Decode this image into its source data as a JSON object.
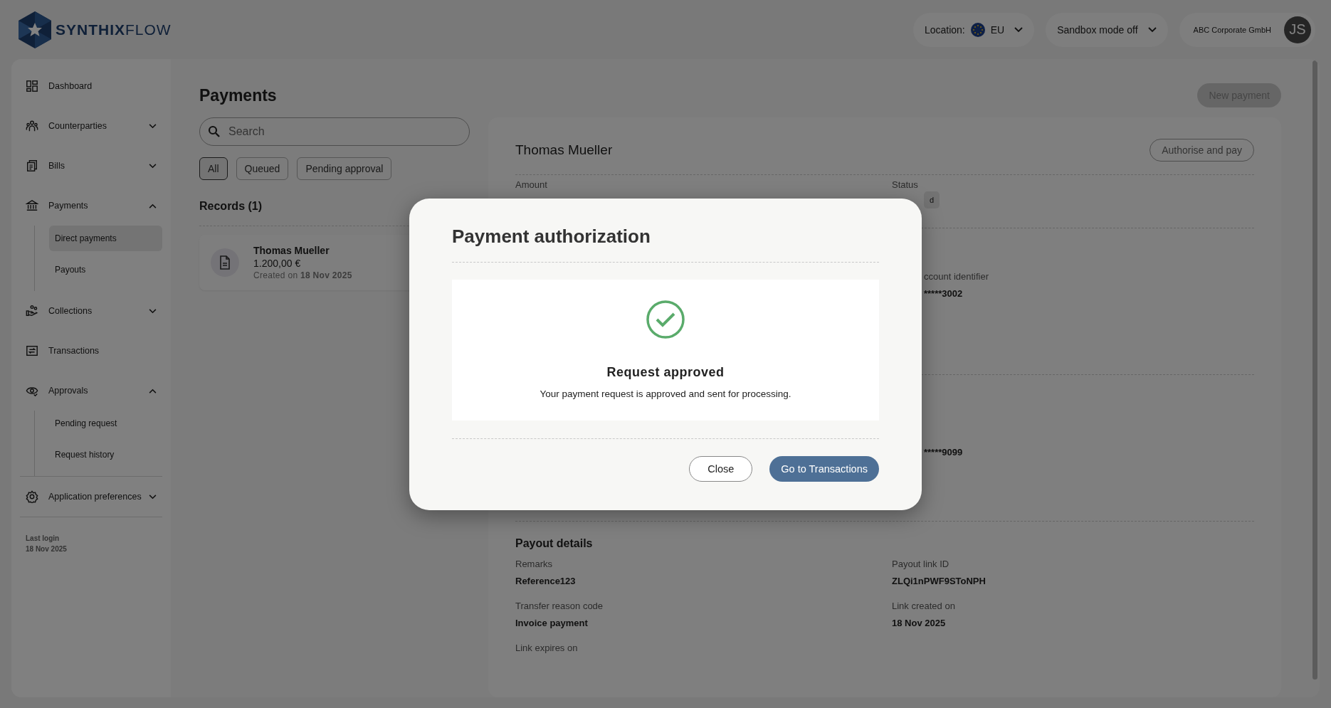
{
  "brand": {
    "name": "**SYNTHIX**FLOW"
  },
  "header": {
    "location_label": "Location:",
    "location_value": "EU",
    "sandbox": "Sandbox mode off",
    "company": "ABC Corporate GmbH",
    "avatar": "JS"
  },
  "sidebar": {
    "items": [
      {
        "label": "Dashboard"
      },
      {
        "label": "Counterparties",
        "expanded": false
      },
      {
        "label": "Bills",
        "expanded": false
      },
      {
        "label": "Payments",
        "expanded": true,
        "children": [
          {
            "label": "Direct payments",
            "selected": true
          },
          {
            "label": "Payouts",
            "selected": false
          }
        ]
      },
      {
        "label": "Collections",
        "expanded": false
      },
      {
        "label": "Transactions"
      },
      {
        "label": "Approvals",
        "expanded": true,
        "children": [
          {
            "label": "Pending request",
            "selected": false
          },
          {
            "label": "Request history",
            "selected": false
          }
        ]
      },
      {
        "label": "Application preferences",
        "expanded": false
      }
    ],
    "last_login": {
      "label": "Last login",
      "date": "18 Nov 2025"
    }
  },
  "page": {
    "title": "Payments",
    "new_button": "New payment",
    "search": {
      "placeholder": "Search"
    },
    "filters": [
      {
        "label": "All",
        "selected": true
      },
      {
        "label": "Queued",
        "selected": false
      },
      {
        "label": "Pending approval",
        "selected": false
      }
    ],
    "records_title": "Records (1)",
    "records": [
      {
        "name": "Thomas Mueller",
        "amount": "1.200,00 €",
        "created": "Created on **18 Nov 2025**"
      }
    ]
  },
  "detail": {
    "name": "Thomas Mueller",
    "action": "Authorise and pay",
    "amount_label": "Amount",
    "status_label": "Status",
    "status_badge": "d",
    "account_label": "ccount identifier",
    "account_value": "*****3002",
    "second_value": "*****9099",
    "payout_title": "Payout details",
    "payout_fields": [
      {
        "label": "Remarks",
        "value": "Reference123"
      },
      {
        "label": "Payout link ID",
        "value": "ZLQi1nPWF9SToNPH"
      },
      {
        "label": "Transfer reason code",
        "value": "Invoice payment"
      },
      {
        "label": "Link created on",
        "value": "18 Nov 2025"
      },
      {
        "label": "Link expires on"
      }
    ]
  },
  "modal": {
    "title": "Payment authorization",
    "result_title": "Request approved",
    "message": "Your payment request is approved and sent for processing.",
    "buttons": [
      {
        "label": "Close",
        "kind": "secondary"
      },
      {
        "label": "Go to Transactions",
        "kind": "primary"
      }
    ]
  }
}
